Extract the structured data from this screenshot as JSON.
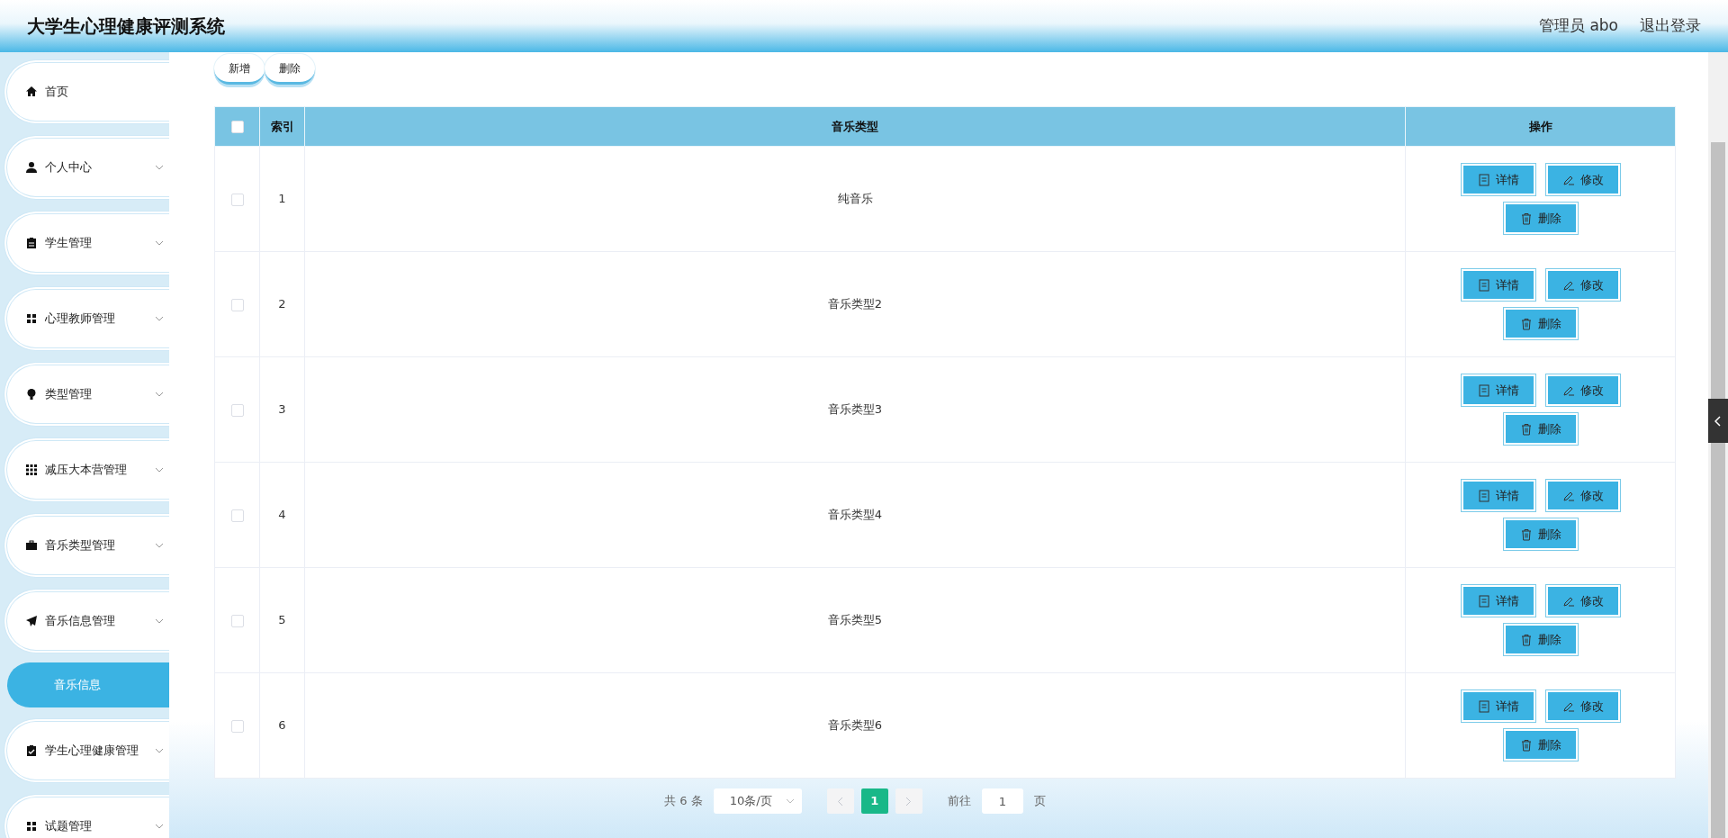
{
  "header": {
    "title": "大学生心理健康评测系统",
    "user": "管理员 abo",
    "logout": "退出登录"
  },
  "sidebar": {
    "items": [
      {
        "label": "首页",
        "expandable": false
      },
      {
        "label": "个人中心",
        "expandable": true
      },
      {
        "label": "学生管理",
        "expandable": true
      },
      {
        "label": "心理教师管理",
        "expandable": true
      },
      {
        "label": "类型管理",
        "expandable": true
      },
      {
        "label": "减压大本营管理",
        "expandable": true
      },
      {
        "label": "音乐类型管理",
        "expandable": true
      },
      {
        "label": "音乐信息管理",
        "expandable": true,
        "children": [
          {
            "label": "音乐信息",
            "selected": true
          }
        ]
      },
      {
        "label": "学生心理健康管理",
        "expandable": true
      },
      {
        "label": "试题管理",
        "expandable": true
      }
    ]
  },
  "toolbar": {
    "buttons": [
      "新增",
      "删除"
    ]
  },
  "table": {
    "select_all": {
      "checked": false
    },
    "columns": [
      "索引",
      "音乐类型",
      "操作"
    ],
    "rows": [
      {
        "checked": false,
        "index": "1",
        "type": "纯音乐",
        "actions": [
          {
            "kind": "detail",
            "label": "详情"
          },
          {
            "kind": "edit",
            "label": "修改"
          },
          {
            "kind": "delete",
            "label": "删除"
          }
        ]
      },
      {
        "checked": false,
        "index": "2",
        "type": "音乐类型2",
        "actions": [
          {
            "kind": "detail",
            "label": "详情"
          },
          {
            "kind": "edit",
            "label": "修改"
          },
          {
            "kind": "delete",
            "label": "删除"
          }
        ]
      },
      {
        "checked": false,
        "index": "3",
        "type": "音乐类型3",
        "actions": [
          {
            "kind": "detail",
            "label": "详情"
          },
          {
            "kind": "edit",
            "label": "修改"
          },
          {
            "kind": "delete",
            "label": "删除"
          }
        ]
      },
      {
        "checked": false,
        "index": "4",
        "type": "音乐类型4",
        "actions": [
          {
            "kind": "detail",
            "label": "详情"
          },
          {
            "kind": "edit",
            "label": "修改"
          },
          {
            "kind": "delete",
            "label": "删除"
          }
        ]
      },
      {
        "checked": false,
        "index": "5",
        "type": "音乐类型5",
        "actions": [
          {
            "kind": "detail",
            "label": "详情"
          },
          {
            "kind": "edit",
            "label": "修改"
          },
          {
            "kind": "delete",
            "label": "删除"
          }
        ]
      },
      {
        "checked": false,
        "index": "6",
        "type": "音乐类型6",
        "actions": [
          {
            "kind": "detail",
            "label": "详情"
          },
          {
            "kind": "edit",
            "label": "修改"
          },
          {
            "kind": "delete",
            "label": "删除"
          }
        ]
      }
    ]
  },
  "pagination": {
    "total": "共 6 条",
    "page_size": "10条/页",
    "prev_disabled": true,
    "next_disabled": true,
    "pages": [
      {
        "label": "1",
        "selected": true
      }
    ],
    "goto_label": "前往",
    "goto_value": "1",
    "goto_unit": "页"
  }
}
